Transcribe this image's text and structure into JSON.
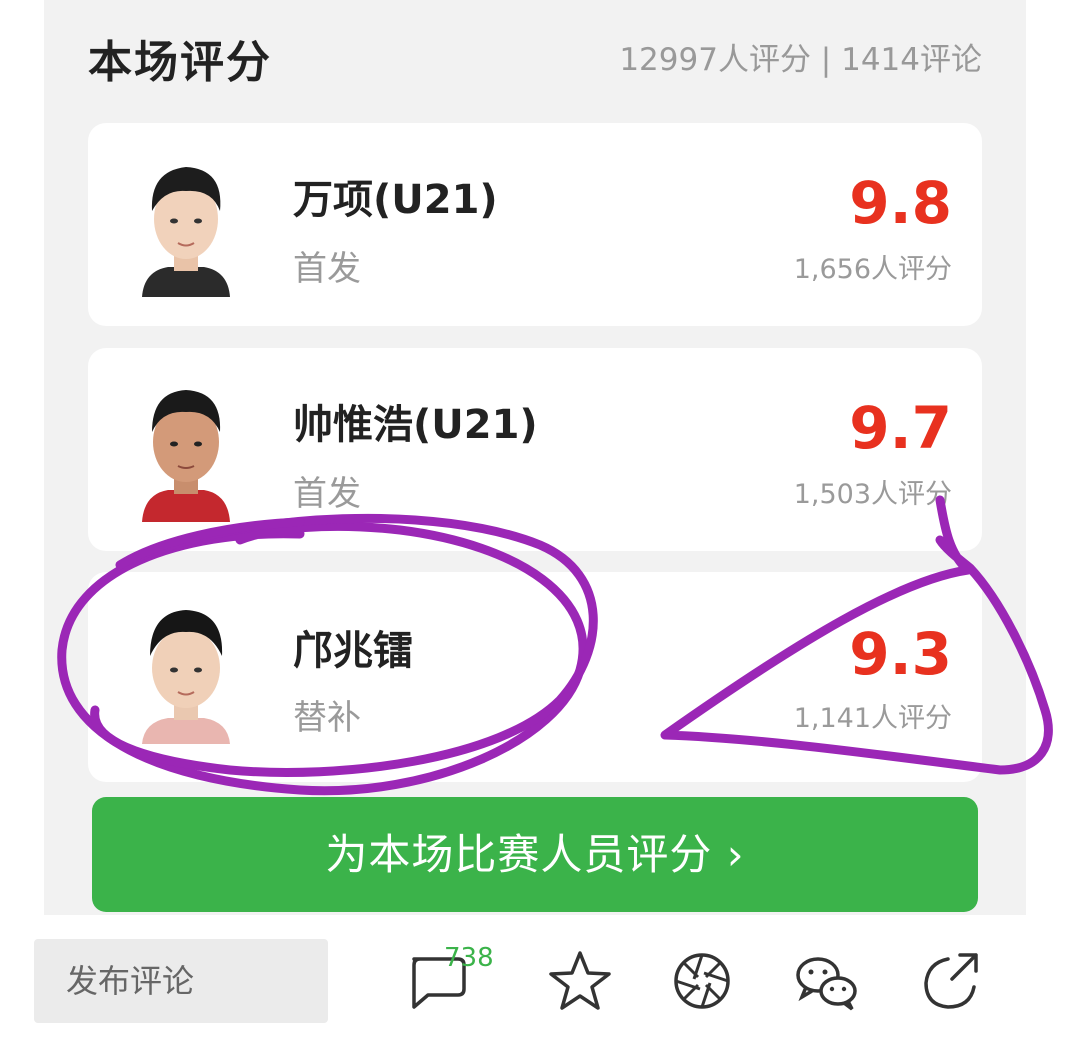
{
  "header": {
    "title": "本场评分",
    "stats": "12997人评分 | 1414评论"
  },
  "players": [
    {
      "name": "万项(U21)",
      "role": "首发",
      "score": "9.8",
      "count": "1,656人评分"
    },
    {
      "name": "帅惟浩(U21)",
      "role": "首发",
      "score": "9.7",
      "count": "1,503人评分"
    },
    {
      "name": "邝兆镭",
      "role": "替补",
      "score": "9.3",
      "count": "1,141人评分"
    }
  ],
  "rate_button": "为本场比赛人员评分 ›",
  "bottom_bar": {
    "comment_placeholder": "发布评论",
    "comment_count": "738",
    "icons": [
      "comment-icon",
      "star-icon",
      "moments-icon",
      "wechat-icon",
      "share-icon"
    ]
  },
  "colors": {
    "score": "#e8311f",
    "accent": "#3bb34a",
    "annotation": "#9b27b6"
  }
}
